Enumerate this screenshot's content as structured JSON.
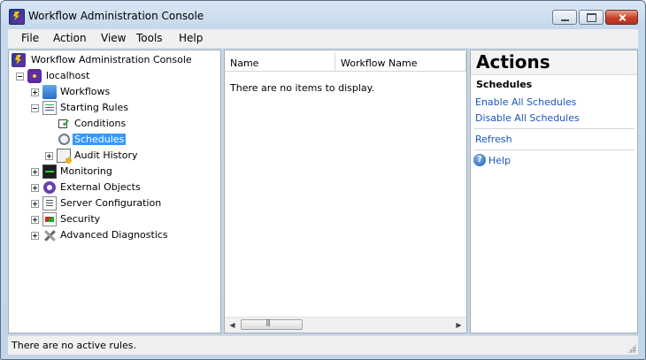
{
  "window": {
    "title": "Workflow Administration Console"
  },
  "menu": {
    "items": [
      "File",
      "Action",
      "View",
      "Tools",
      "Help"
    ]
  },
  "tree": {
    "root": "Workflow Administration Console",
    "host": "localhost",
    "workflows": "Workflows",
    "starting_rules": "Starting Rules",
    "conditions": "Conditions",
    "schedules": "Schedules",
    "audit_history": "Audit History",
    "monitoring": "Monitoring",
    "external_objects": "External Objects",
    "server_configuration": "Server Configuration",
    "security": "Security",
    "advanced_diagnostics": "Advanced Diagnostics",
    "selected": "Schedules"
  },
  "list": {
    "columns": [
      "Name",
      "Workflow Name"
    ],
    "empty_message": "There are no items to display.",
    "scroll_thumb_glyph": "III"
  },
  "actions": {
    "title": "Actions",
    "section": "Schedules",
    "enable_all": "Enable All Schedules",
    "disable_all": "Disable All Schedules",
    "refresh": "Refresh",
    "help": "Help"
  },
  "status": {
    "text": "There are no active rules."
  },
  "icons": {
    "app": "workflow-app-icon",
    "host": "server-gear-icon",
    "help": "help-question-icon"
  },
  "colors": {
    "selection": "#3399ff",
    "link": "#1a56b8",
    "close_button": "#c9402b"
  }
}
